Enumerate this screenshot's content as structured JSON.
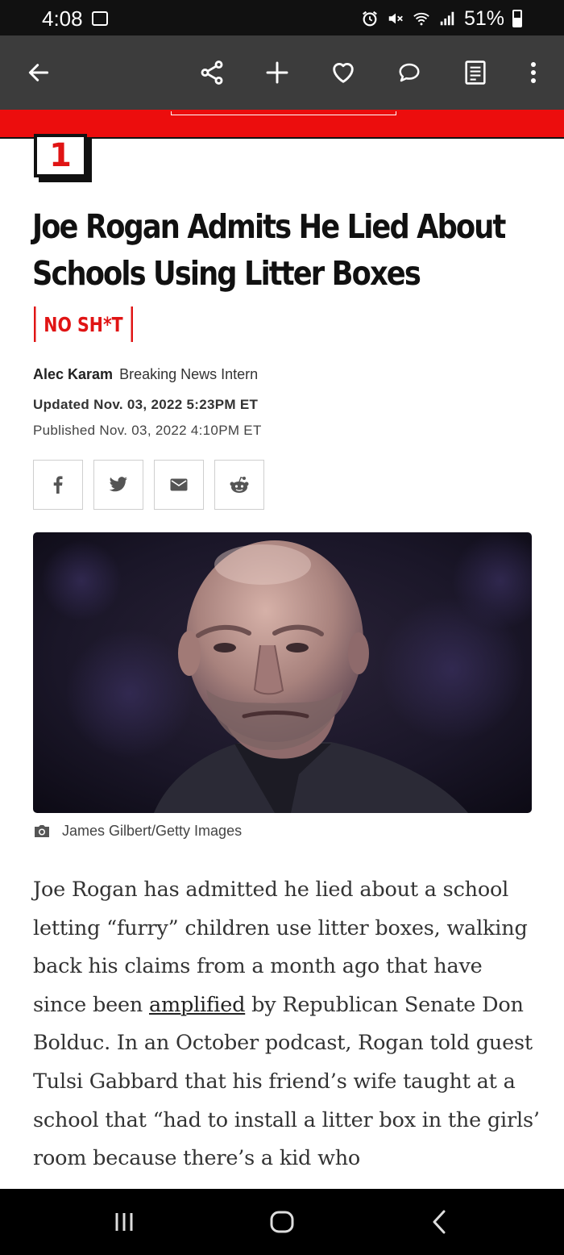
{
  "status_bar": {
    "time": "4:08",
    "battery_percent": "51%",
    "icons": [
      "image-icon",
      "alarm-icon",
      "mute-icon",
      "wifi-icon",
      "signal-icon",
      "battery-icon"
    ]
  },
  "toolbar": {
    "icons": [
      "back-arrow-icon",
      "share-icon",
      "add-icon",
      "heart-icon",
      "comment-icon",
      "reader-icon",
      "more-icon"
    ]
  },
  "article": {
    "rank": "1",
    "headline": "Joe Rogan Admits He Lied About Schools Using Litter Boxes",
    "tag": "NO SH*T",
    "author": "Alec Karam",
    "author_role": "Breaking News Intern",
    "updated": "Updated Nov. 03, 2022 5:23PM ET",
    "published": "Published Nov. 03, 2022 4:10PM ET",
    "share_buttons": [
      "facebook-icon",
      "twitter-icon",
      "email-icon",
      "reddit-icon"
    ],
    "photo_caption": "James Gilbert/Getty Images",
    "body_part1": "Joe Rogan has admitted he lied about a school letting “furry” children use litter boxes, walking back his claims from a month ago that have since been ",
    "body_link": "amplified",
    "body_part2": " by Republican Senate Don Bolduc. In an October podcast, Rogan told guest Tulsi Gabbard that his friend’s wife taught at a school that “had to install a litter box in the girls’ room because there’s a kid who"
  },
  "nav_bar": {
    "buttons": [
      "recent-apps-icon",
      "home-icon",
      "back-icon"
    ]
  },
  "colors": {
    "accent_red": "#e01414",
    "toolbar_bg": "#3c3c3c",
    "status_bg": "#111111"
  }
}
